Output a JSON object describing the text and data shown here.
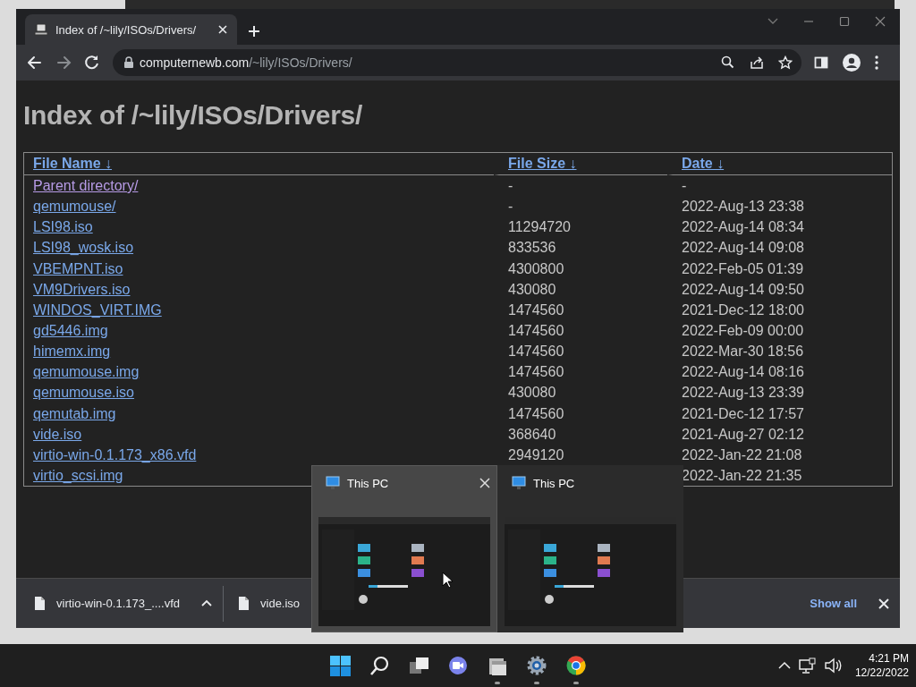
{
  "browser": {
    "tab": {
      "title": "Index of /~lily/ISOs/Drivers/",
      "selected": true
    },
    "toolbar": {
      "forward_disabled": true,
      "address_host": "computernewb.com",
      "address_path": "/~lily/ISOs/Drivers/"
    }
  },
  "page": {
    "heading": "Index of /~lily/ISOs/Drivers/",
    "columns": [
      {
        "label": "File Name",
        "sort": "↓"
      },
      {
        "label": "File Size",
        "sort": "↓"
      },
      {
        "label": "Date",
        "sort": "↓"
      }
    ],
    "rows": [
      {
        "name": "Parent directory/",
        "size": "-",
        "date": "-",
        "visited": true
      },
      {
        "name": "qemumouse/",
        "size": "-",
        "date": "2022-Aug-13 23:38",
        "visited": false
      },
      {
        "name": "LSI98.iso",
        "size": "11294720",
        "date": "2022-Aug-14 08:34",
        "visited": false
      },
      {
        "name": "LSI98_wosk.iso",
        "size": "833536",
        "date": "2022-Aug-14 09:08",
        "visited": false
      },
      {
        "name": "VBEMPNT.iso",
        "size": "4300800",
        "date": "2022-Feb-05 01:39",
        "visited": false
      },
      {
        "name": "VM9Drivers.iso",
        "size": "430080",
        "date": "2022-Aug-14 09:50",
        "visited": false
      },
      {
        "name": "WINDOS_VIRT.IMG",
        "size": "1474560",
        "date": "2021-Dec-12 18:00",
        "visited": false
      },
      {
        "name": "gd5446.img",
        "size": "1474560",
        "date": "2022-Feb-09 00:00",
        "visited": false
      },
      {
        "name": "himemx.img",
        "size": "1474560",
        "date": "2022-Mar-30 18:56",
        "visited": false
      },
      {
        "name": "qemumouse.img",
        "size": "1474560",
        "date": "2022-Aug-14 08:16",
        "visited": false
      },
      {
        "name": "qemumouse.iso",
        "size": "430080",
        "date": "2022-Aug-13 23:39",
        "visited": false
      },
      {
        "name": "qemutab.img",
        "size": "1474560",
        "date": "2021-Dec-12 17:57",
        "visited": false
      },
      {
        "name": "vide.iso",
        "size": "368640",
        "date": "2021-Aug-27 02:12",
        "visited": false
      },
      {
        "name": "virtio-win-0.1.173_x86.vfd",
        "size": "2949120",
        "date": "2022-Jan-22 21:08",
        "visited": false
      },
      {
        "name": "virtio_scsi.img",
        "date": "2022-Jan-22 21:35",
        "visited": false
      }
    ]
  },
  "download_bar": {
    "items": [
      {
        "filename": "virtio-win-0.1.173_....vfd",
        "has_menu": true
      },
      {
        "filename": "vide.iso",
        "has_menu": false
      }
    ],
    "show_all": "Show all"
  },
  "previews": [
    {
      "title": "This PC",
      "hovered": true
    },
    {
      "title": "This PC",
      "hovered": false
    }
  ],
  "taskbar": {
    "apps": [
      {
        "kind": "start",
        "running": false
      },
      {
        "kind": "search",
        "running": false
      },
      {
        "kind": "taskview",
        "running": false
      },
      {
        "kind": "chat",
        "running": false
      },
      {
        "kind": "explorer",
        "running": true
      },
      {
        "kind": "settings",
        "running": true
      },
      {
        "kind": "chrome",
        "running": true
      }
    ],
    "time": "4:21 PM",
    "date": "12/22/2022"
  }
}
